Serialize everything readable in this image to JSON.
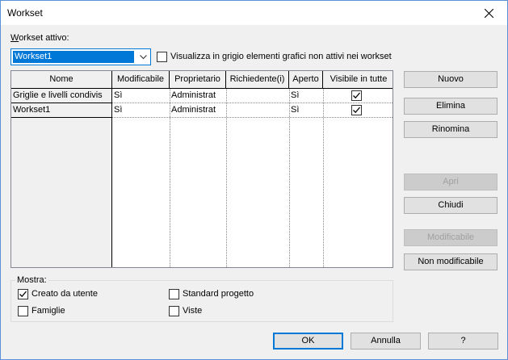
{
  "window": {
    "title": "Workset"
  },
  "active_workset": {
    "label": "Workset attivo:",
    "selected": "Workset1",
    "gray_checkbox_label": "Visualizza in grigio elementi grafici non attivi nei workset",
    "gray_checked": false
  },
  "table": {
    "columns": [
      "Nome",
      "Modificabile",
      "Proprietario",
      "Richiedente(i)",
      "Aperto",
      "Visibile in tutte"
    ],
    "rows": [
      {
        "name": "Griglie e livelli condivis",
        "editable": "Sì",
        "owner": "Administrat",
        "requesters": "",
        "open": "Sì",
        "visible": true
      },
      {
        "name": "Workset1",
        "editable": "Sì",
        "owner": "Administrat",
        "requesters": "",
        "open": "Sì",
        "visible": true
      }
    ]
  },
  "buttons": {
    "new": "Nuovo",
    "delete": "Elimina",
    "rename": "Rinomina",
    "open": "Apri",
    "close": "Chiudi",
    "editable": "Modificabile",
    "non_editable": "Non modificabile",
    "ok": "OK",
    "cancel": "Annulla",
    "help": "?"
  },
  "show": {
    "label": "Mostra:",
    "user_created": {
      "label": "Creato da utente",
      "checked": true
    },
    "families": {
      "label": "Famiglie",
      "checked": false
    },
    "project_standards": {
      "label": "Standard progetto",
      "checked": false
    },
    "views": {
      "label": "Viste",
      "checked": false
    }
  }
}
